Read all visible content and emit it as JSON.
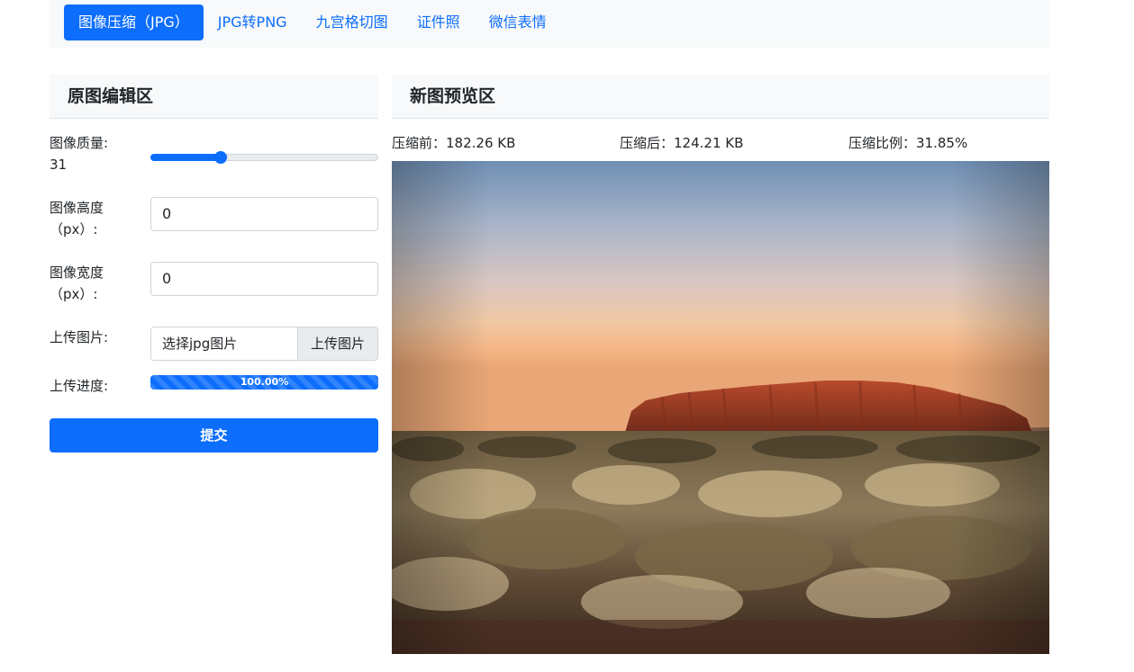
{
  "nav": {
    "tabs": [
      {
        "label": "图像压缩（JPG）",
        "active": true
      },
      {
        "label": "JPG转PNG",
        "active": false
      },
      {
        "label": "九宫格切图",
        "active": false
      },
      {
        "label": "证件照",
        "active": false
      },
      {
        "label": "微信表情",
        "active": false
      }
    ]
  },
  "left_panel": {
    "title": "原图编辑区",
    "quality": {
      "label": "图像质量:",
      "value": "31",
      "fraction": 0.31
    },
    "height": {
      "label": "图像高度",
      "unit": "（px）:",
      "value": "0"
    },
    "width": {
      "label": "图像宽度",
      "unit": "（px）:",
      "value": "0"
    },
    "upload": {
      "label": "上传图片:",
      "placeholder": "选择jpg图片",
      "button": "上传图片"
    },
    "progress": {
      "label": "上传进度:",
      "text": "100.00%",
      "percent": 100
    },
    "submit": "提交"
  },
  "right_panel": {
    "title": "新图预览区",
    "before": "压缩前：182.26 KB",
    "after": "压缩后：124.21 KB",
    "ratio": "压缩比例：31.85%"
  },
  "colors": {
    "primary": "#0d6efd",
    "nav_bg": "#f8f9fa",
    "border": "#ced4da"
  }
}
